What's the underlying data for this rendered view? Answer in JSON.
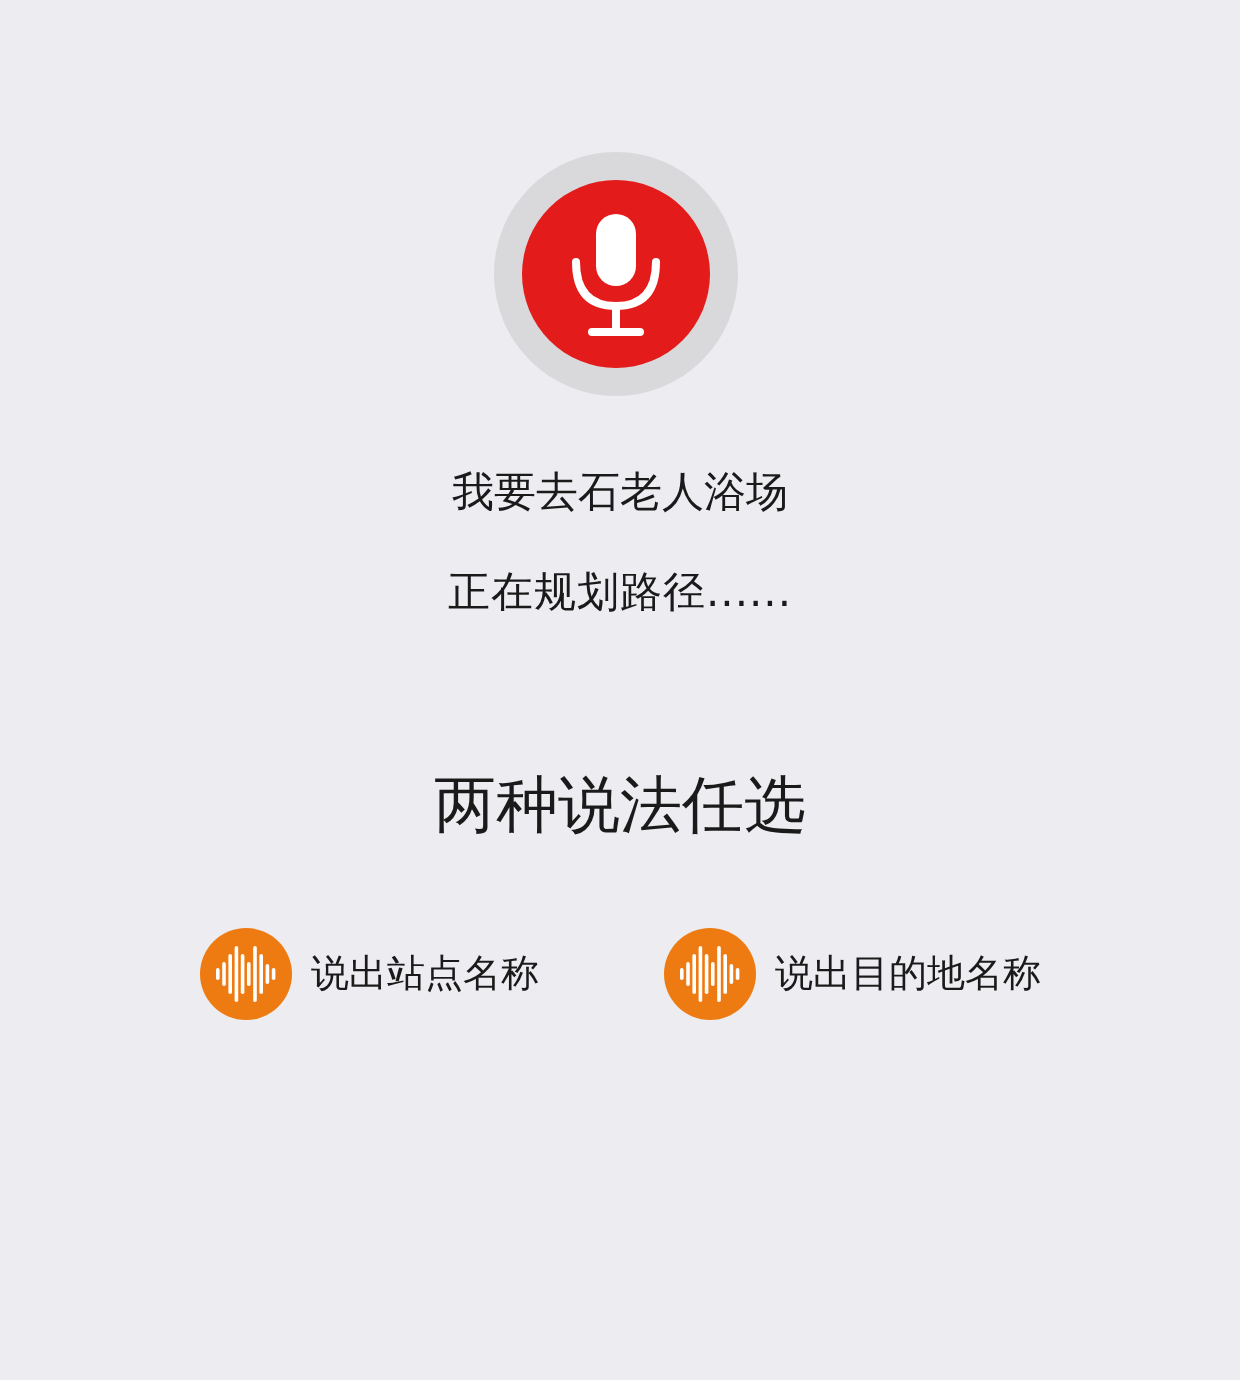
{
  "voice": {
    "recognized_text": "我要去石老人浴场",
    "status": "正在规划路径......"
  },
  "hints": {
    "title": "两种说法任选",
    "options": [
      {
        "label": "说出站点名称"
      },
      {
        "label": "说出目的地名称"
      }
    ]
  }
}
